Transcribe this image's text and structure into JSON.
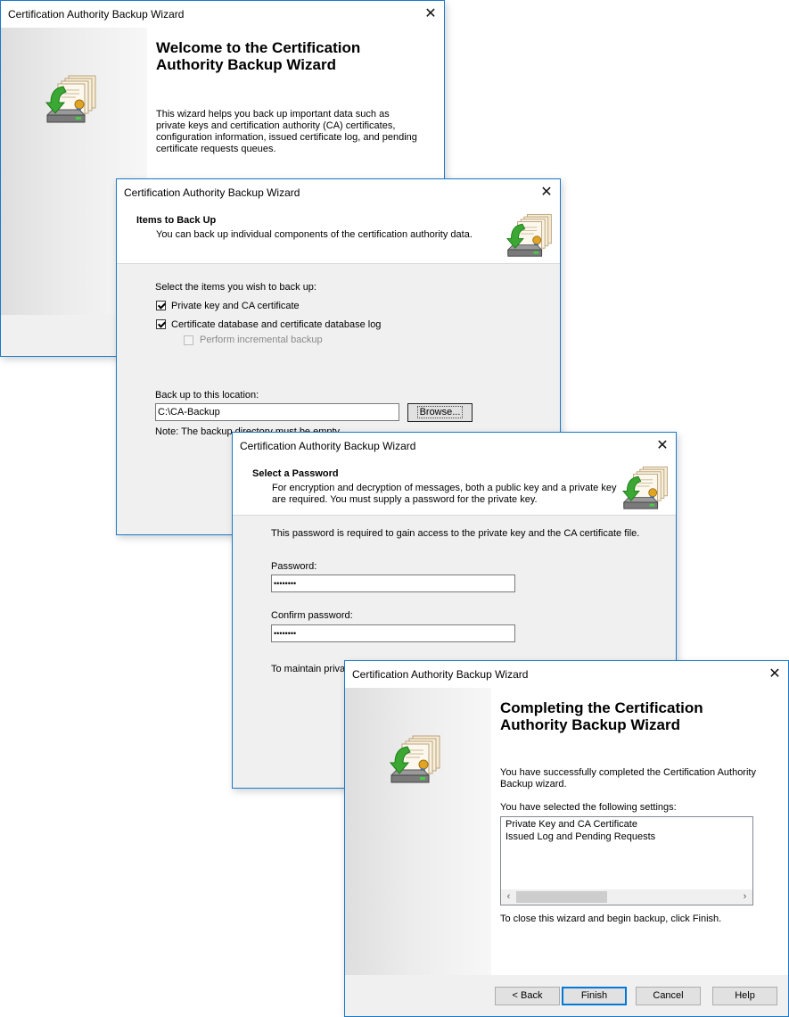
{
  "window_title": "Certification Authority Backup Wizard",
  "close_glyph": "✕",
  "w1": {
    "heading_l1": "Welcome to the Certification",
    "heading_l2": "Authority Backup Wizard",
    "body_l1": "This wizard helps you back up important data such as",
    "body_l2": "private keys and certification authority (CA) certificates,",
    "body_l3": "configuration information, issued certificate log, and pending",
    "body_l4": "certificate requests queues."
  },
  "w2": {
    "header_title": "Items to Back Up",
    "header_sub": "You can back up individual components of the certification authority data.",
    "select_prompt": "Select the items you wish to back up:",
    "items": [
      {
        "label": "Private key and CA certificate",
        "checked": true,
        "disabled": false
      },
      {
        "label": "Certificate database and certificate database log",
        "checked": true,
        "disabled": false
      },
      {
        "label": "Perform incremental backup",
        "checked": false,
        "disabled": true
      }
    ],
    "location_label": "Back up to this location:",
    "location_value": "C:\\CA-Backup",
    "browse_label": "Browse...",
    "note": "Note: The backup directory must be empty."
  },
  "w3": {
    "header_title": "Select a Password",
    "header_sub_l1": "For encryption and decryption of messages, both a public key and a private key",
    "header_sub_l2": "are required. You must supply a password for the private key.",
    "intro": "This password is required to gain access to the private key and the CA certificate file.",
    "password_label": "Password:",
    "password_value": "••••••••",
    "confirm_label": "Confirm password:",
    "confirm_value": "••••••••",
    "maintain_text": "To maintain privat"
  },
  "w4": {
    "heading_l1": "Completing the Certification",
    "heading_l2": "Authority Backup Wizard",
    "success_l1": "You have successfully completed the Certification Authority",
    "success_l2": "Backup wizard.",
    "settings_label": "You have selected the following settings:",
    "settings": [
      "Private Key and CA Certificate",
      "Issued Log and Pending Requests"
    ],
    "close_text": "To close this wizard and begin backup, click Finish.",
    "buttons": {
      "back": "< Back",
      "finish": "Finish",
      "cancel": "Cancel",
      "help": "Help"
    }
  },
  "colors": {
    "accent_border": "#1979ca",
    "default_button": "#0078d7",
    "arrow_green": "#3aa832"
  }
}
